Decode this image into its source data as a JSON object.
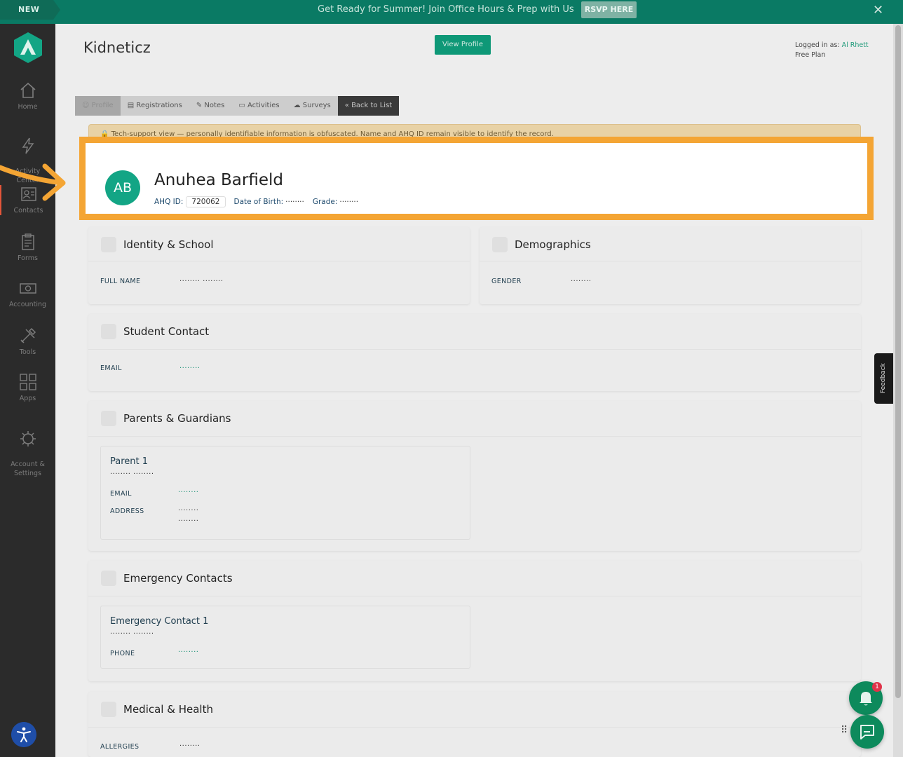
{
  "banner": {
    "new_label": "NEW",
    "message": "Get Ready for Summer! Join Office Hours & Prep with Us",
    "rsvp_label": "RSVP HERE",
    "close_icon": "close-icon"
  },
  "sidebar": {
    "items": [
      {
        "label": "Home",
        "icon": "home-icon"
      },
      {
        "label": "Activity\nCenter",
        "icon": "lightning-icon"
      },
      {
        "label": "Contacts",
        "icon": "contacts-icon"
      },
      {
        "label": "Forms",
        "icon": "clipboard-icon"
      },
      {
        "label": "Accounting",
        "icon": "money-icon"
      },
      {
        "label": "Tools",
        "icon": "tools-icon"
      },
      {
        "label": "Apps",
        "icon": "apps-grid-icon"
      },
      {
        "label": "Account &\nSettings",
        "icon": "gear-icon"
      }
    ]
  },
  "header": {
    "org_name": "Kidneticz",
    "view_profile_label": "View Profile",
    "logged_in_prefix": "Logged in as:",
    "logged_in_user": "Al Rhett",
    "plan": "Free Plan"
  },
  "tabs": [
    {
      "label": "Profile",
      "icon": "profile-icon"
    },
    {
      "label": "Registrations",
      "icon": "clipboard-icon"
    },
    {
      "label": "Notes",
      "icon": "edit-icon"
    },
    {
      "label": "Activities",
      "icon": "activities-icon"
    },
    {
      "label": "Surveys",
      "icon": "cloud-icon"
    },
    {
      "label": "« Back to List",
      "icon": ""
    }
  ],
  "notice": {
    "text": "Tech-support view — personally identifiable information is obfuscated. Name and AHQ ID remain visible to identify the record."
  },
  "student": {
    "initials": "AB",
    "name": "Anuhea Barfield",
    "ahq_label": "AHQ ID:",
    "ahq_id": "720062",
    "dob_label": "Date of Birth:",
    "dob": "········",
    "grade_label": "Grade:",
    "grade": "········"
  },
  "identity": {
    "title": "Identity & School",
    "full_name_label": "FULL NAME",
    "full_name": "········ ········"
  },
  "demographics": {
    "title": "Demographics",
    "gender_label": "GENDER",
    "gender": "········"
  },
  "student_contact": {
    "title": "Student Contact",
    "email_label": "EMAIL",
    "email": "········"
  },
  "parents": {
    "title": "Parents & Guardians",
    "parent_title": "Parent 1",
    "parent_name": "········ ········",
    "email_label": "EMAIL",
    "email": "········",
    "address_label": "ADDRESS",
    "address_line1": "········",
    "address_line2": "········"
  },
  "emergency": {
    "title": "Emergency Contacts",
    "contact_title": "Emergency Contact 1",
    "contact_name": "········ ········",
    "phone_label": "PHONE",
    "phone": "········"
  },
  "medical": {
    "title": "Medical & Health",
    "allergies_label": "ALLERGIES",
    "allergies": "········"
  },
  "feedback_label": "Feedback",
  "notification_count": "1",
  "colors": {
    "brand": "#0a7a64",
    "accent": "#13a585",
    "highlight": "#f4a534",
    "sidebar": "#2b2b2b"
  }
}
